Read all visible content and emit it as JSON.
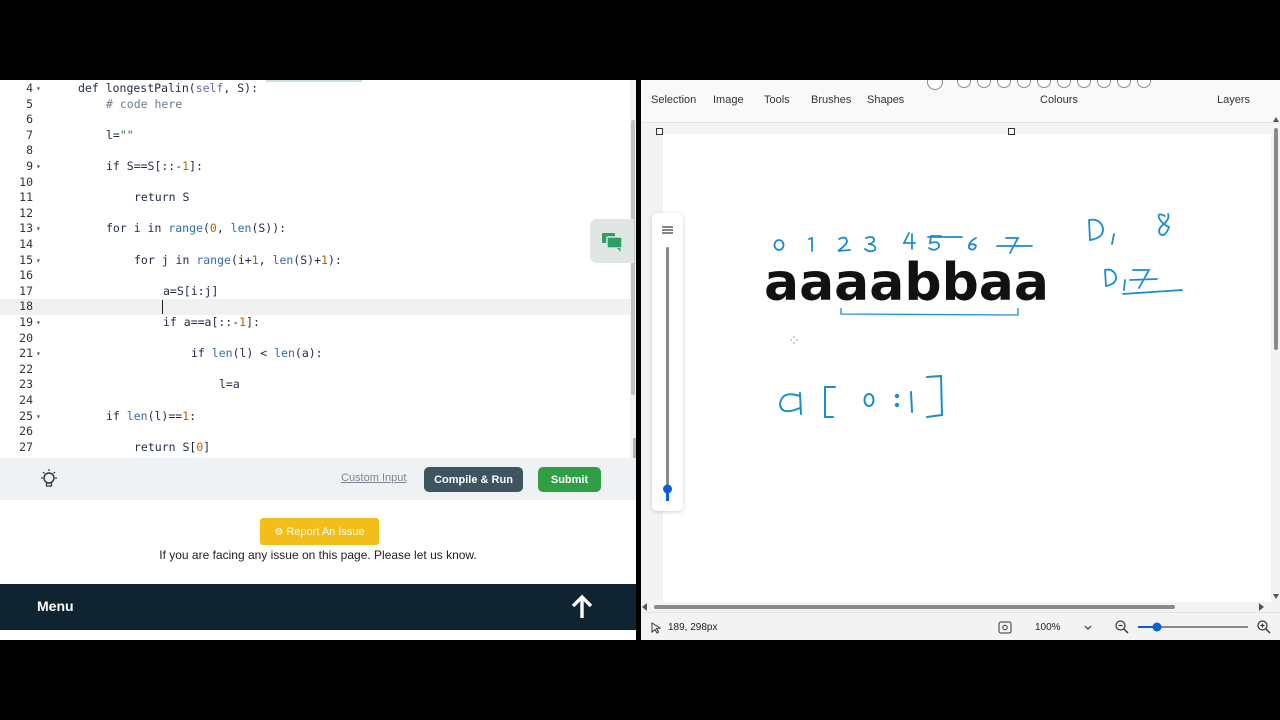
{
  "editor": {
    "lines": [
      {
        "num": "4",
        "fold": true,
        "indent": 78,
        "tokens": [
          {
            "t": "def longestPalin(",
            "c": "#1f2a44"
          },
          {
            "t": "self",
            "c": "#7b5ea7"
          },
          {
            "t": ", S):",
            "c": "#1f2a44"
          }
        ]
      },
      {
        "num": "5",
        "fold": false,
        "indent": 106,
        "tokens": [
          {
            "t": "# code here",
            "c": "#6b7b8c"
          }
        ]
      },
      {
        "num": "6",
        "fold": false,
        "indent": 106,
        "tokens": []
      },
      {
        "num": "7",
        "fold": false,
        "indent": 106,
        "tokens": [
          {
            "t": "l=",
            "c": "#1f2a44"
          },
          {
            "t": "\"\"",
            "c": "#2c7a3f"
          }
        ]
      },
      {
        "num": "8",
        "fold": false,
        "indent": 106,
        "tokens": []
      },
      {
        "num": "9",
        "fold": true,
        "indent": 106,
        "tokens": [
          {
            "t": "if S==S[::-",
            "c": "#1f2a44"
          },
          {
            "t": "1",
            "c": "#b06000"
          },
          {
            "t": "]:",
            "c": "#1f2a44"
          }
        ]
      },
      {
        "num": "10",
        "fold": false,
        "indent": 106,
        "tokens": []
      },
      {
        "num": "11",
        "fold": false,
        "indent": 134,
        "tokens": [
          {
            "t": "return S",
            "c": "#1f2a44"
          }
        ]
      },
      {
        "num": "12",
        "fold": false,
        "indent": 106,
        "tokens": []
      },
      {
        "num": "13",
        "fold": true,
        "indent": 106,
        "tokens": [
          {
            "t": "for i in ",
            "c": "#1f2a44"
          },
          {
            "t": "range",
            "c": "#2f6db3"
          },
          {
            "t": "(",
            "c": "#1f2a44"
          },
          {
            "t": "0",
            "c": "#b06000"
          },
          {
            "t": ", ",
            "c": "#1f2a44"
          },
          {
            "t": "len",
            "c": "#2f6db3"
          },
          {
            "t": "(S)):",
            "c": "#1f2a44"
          }
        ]
      },
      {
        "num": "14",
        "fold": false,
        "indent": 106,
        "tokens": []
      },
      {
        "num": "15",
        "fold": true,
        "indent": 134,
        "tokens": [
          {
            "t": "for j in ",
            "c": "#1f2a44"
          },
          {
            "t": "range",
            "c": "#2f6db3"
          },
          {
            "t": "(i+",
            "c": "#1f2a44"
          },
          {
            "t": "1",
            "c": "#b06000"
          },
          {
            "t": ", ",
            "c": "#1f2a44"
          },
          {
            "t": "len",
            "c": "#2f6db3"
          },
          {
            "t": "(S)+",
            "c": "#1f2a44"
          },
          {
            "t": "1",
            "c": "#b06000"
          },
          {
            "t": "):",
            "c": "#1f2a44"
          }
        ]
      },
      {
        "num": "16",
        "fold": false,
        "indent": 134,
        "tokens": []
      },
      {
        "num": "17",
        "fold": false,
        "indent": 163,
        "tokens": [
          {
            "t": "a=S[i:j]",
            "c": "#1f2a44"
          }
        ]
      },
      {
        "num": "18",
        "fold": false,
        "indent": 163,
        "tokens": [],
        "active": true
      },
      {
        "num": "19",
        "fold": true,
        "indent": 163,
        "tokens": [
          {
            "t": "if a==a[::-",
            "c": "#1f2a44"
          },
          {
            "t": "1",
            "c": "#b06000"
          },
          {
            "t": "]:",
            "c": "#1f2a44"
          }
        ]
      },
      {
        "num": "20",
        "fold": false,
        "indent": 163,
        "tokens": []
      },
      {
        "num": "21",
        "fold": true,
        "indent": 191,
        "tokens": [
          {
            "t": "if ",
            "c": "#1f2a44"
          },
          {
            "t": "len",
            "c": "#2f6db3"
          },
          {
            "t": "(l) < ",
            "c": "#1f2a44"
          },
          {
            "t": "len",
            "c": "#2f6db3"
          },
          {
            "t": "(a):",
            "c": "#1f2a44"
          }
        ]
      },
      {
        "num": "22",
        "fold": false,
        "indent": 191,
        "tokens": []
      },
      {
        "num": "23",
        "fold": false,
        "indent": 219,
        "tokens": [
          {
            "t": "l=a",
            "c": "#1f2a44"
          }
        ]
      },
      {
        "num": "24",
        "fold": false,
        "indent": 106,
        "tokens": []
      },
      {
        "num": "25",
        "fold": true,
        "indent": 106,
        "tokens": [
          {
            "t": "if ",
            "c": "#1f2a44"
          },
          {
            "t": "len",
            "c": "#2f6db3"
          },
          {
            "t": "(l)==",
            "c": "#1f2a44"
          },
          {
            "t": "1",
            "c": "#b06000"
          },
          {
            "t": ":",
            "c": "#1f2a44"
          }
        ]
      },
      {
        "num": "26",
        "fold": false,
        "indent": 106,
        "tokens": []
      },
      {
        "num": "27",
        "fold": false,
        "indent": 134,
        "tokens": [
          {
            "t": "return S[",
            "c": "#1f2a44"
          },
          {
            "t": "0",
            "c": "#b06000"
          },
          {
            "t": "]",
            "c": "#1f2a44"
          }
        ]
      }
    ]
  },
  "actions": {
    "custom_input": "Custom Input",
    "compile_run": "Compile & Run",
    "submit": "Submit"
  },
  "report": {
    "button": "Report An Issue",
    "text": "If you are facing any issue on this page. Please let us know."
  },
  "menu": {
    "label": "Menu",
    "icon": "arrow-up-icon"
  },
  "paint": {
    "toolbar": {
      "selection": "Selection",
      "image": "Image",
      "tools": "Tools",
      "brushes": "Brushes",
      "shapes": "Shapes",
      "colours": "Colours",
      "layers": "Layers"
    },
    "canvas_text": {
      "word": "aaaabbaa",
      "indices": "0 1 2 3 4 5 6 7",
      "note1": "0, 8",
      "note2": "0, 7",
      "note3": "a[0:1]"
    },
    "ink_color": "#1b8ccf",
    "status": {
      "coords": "189, 298px",
      "zoom": "100%"
    }
  }
}
